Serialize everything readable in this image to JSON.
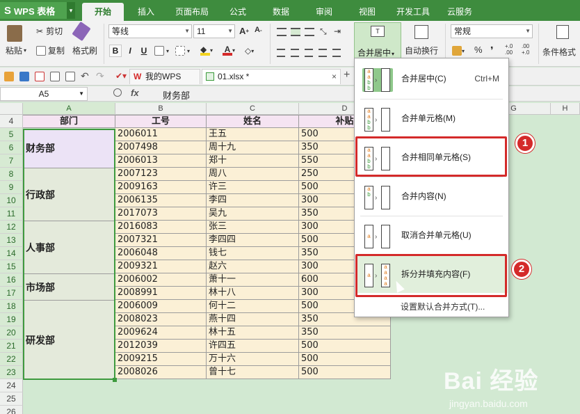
{
  "app": {
    "title": "WPS 表格",
    "logo": "S"
  },
  "menu_tabs": [
    "开始",
    "插入",
    "页面布局",
    "公式",
    "数据",
    "审阅",
    "视图",
    "开发工具",
    "云服务"
  ],
  "ribbon": {
    "paste": "粘贴",
    "cut": "剪切",
    "copy": "复制",
    "format_painter": "格式刷",
    "font_name": "等线",
    "font_size": "11",
    "bold": "B",
    "italic": "I",
    "underline": "U",
    "merge_center": "合并居中",
    "wrap_text": "自动换行",
    "number_format": "常规",
    "percent": "%",
    "comma": "❜",
    "dec_increase": "+.0\n.00",
    "dec_decrease": ".00\n+.0",
    "cond_format": "条件格式"
  },
  "doc_tabs": [
    {
      "label": "我的WPS"
    },
    {
      "label": "01.xlsx *"
    }
  ],
  "formula_bar": {
    "cell_ref": "A5",
    "fx": "fx",
    "content": "财务部"
  },
  "columns": [
    "A",
    "B",
    "C",
    "D",
    "E",
    "F",
    "G",
    "H"
  ],
  "rows": [
    "4",
    "5",
    "6",
    "7",
    "8",
    "9",
    "10",
    "11",
    "12",
    "13",
    "14",
    "15",
    "16",
    "17",
    "18",
    "19",
    "20",
    "21",
    "22",
    "23",
    "24",
    "25",
    "26"
  ],
  "table": {
    "headers": [
      "部门",
      "工号",
      "姓名",
      "补贴"
    ],
    "departments": [
      {
        "name": "财务部"
      },
      {
        "name": "行政部"
      },
      {
        "name": "人事部"
      },
      {
        "name": "市场部"
      },
      {
        "name": "研发部"
      }
    ],
    "rows": [
      [
        "2006011",
        "王五",
        "500"
      ],
      [
        "2007498",
        "周十九",
        "350"
      ],
      [
        "2006013",
        "郑十",
        "550"
      ],
      [
        "2007123",
        "周八",
        "250"
      ],
      [
        "2009163",
        "许三",
        "500"
      ],
      [
        "2006135",
        "李四",
        "300"
      ],
      [
        "2017073",
        "吴九",
        "350"
      ],
      [
        "2016083",
        "张三",
        "300"
      ],
      [
        "2007321",
        "李四四",
        "500"
      ],
      [
        "2006048",
        "钱七",
        "350"
      ],
      [
        "2009321",
        "赵六",
        "300"
      ],
      [
        "2006002",
        "萧十一",
        "600"
      ],
      [
        "2008991",
        "林十八",
        "300"
      ],
      [
        "2006009",
        "何十二",
        "500"
      ],
      [
        "2008023",
        "燕十四",
        "350"
      ],
      [
        "2009624",
        "林十五",
        "350"
      ],
      [
        "2012039",
        "许四五",
        "500"
      ],
      [
        "2009215",
        "万十六",
        "500"
      ],
      [
        "2008026",
        "曾十七",
        "500"
      ]
    ]
  },
  "dropdown": {
    "items": [
      {
        "label": "合并居中(C)",
        "shortcut": "Ctrl+M"
      },
      {
        "label": "合并单元格(M)",
        "shortcut": ""
      },
      {
        "label": "合并相同单元格(S)",
        "shortcut": ""
      },
      {
        "label": "合并内容(N)",
        "shortcut": ""
      },
      {
        "label": "取消合并单元格(U)",
        "shortcut": ""
      },
      {
        "label": "拆分并填充内容(F)",
        "shortcut": ""
      }
    ],
    "footer": "设置默认合并方式(T)..."
  },
  "annotations": {
    "badge1": "1",
    "badge2": "2"
  },
  "watermark": {
    "main": "Bai 经验",
    "sub": "jingyan.baidu.com"
  },
  "colors": {
    "accent": "#3e8c3e",
    "highlight": "#d42a2a",
    "header_fill": "#f5e4f2",
    "data_fill": "#fbf0d6"
  }
}
